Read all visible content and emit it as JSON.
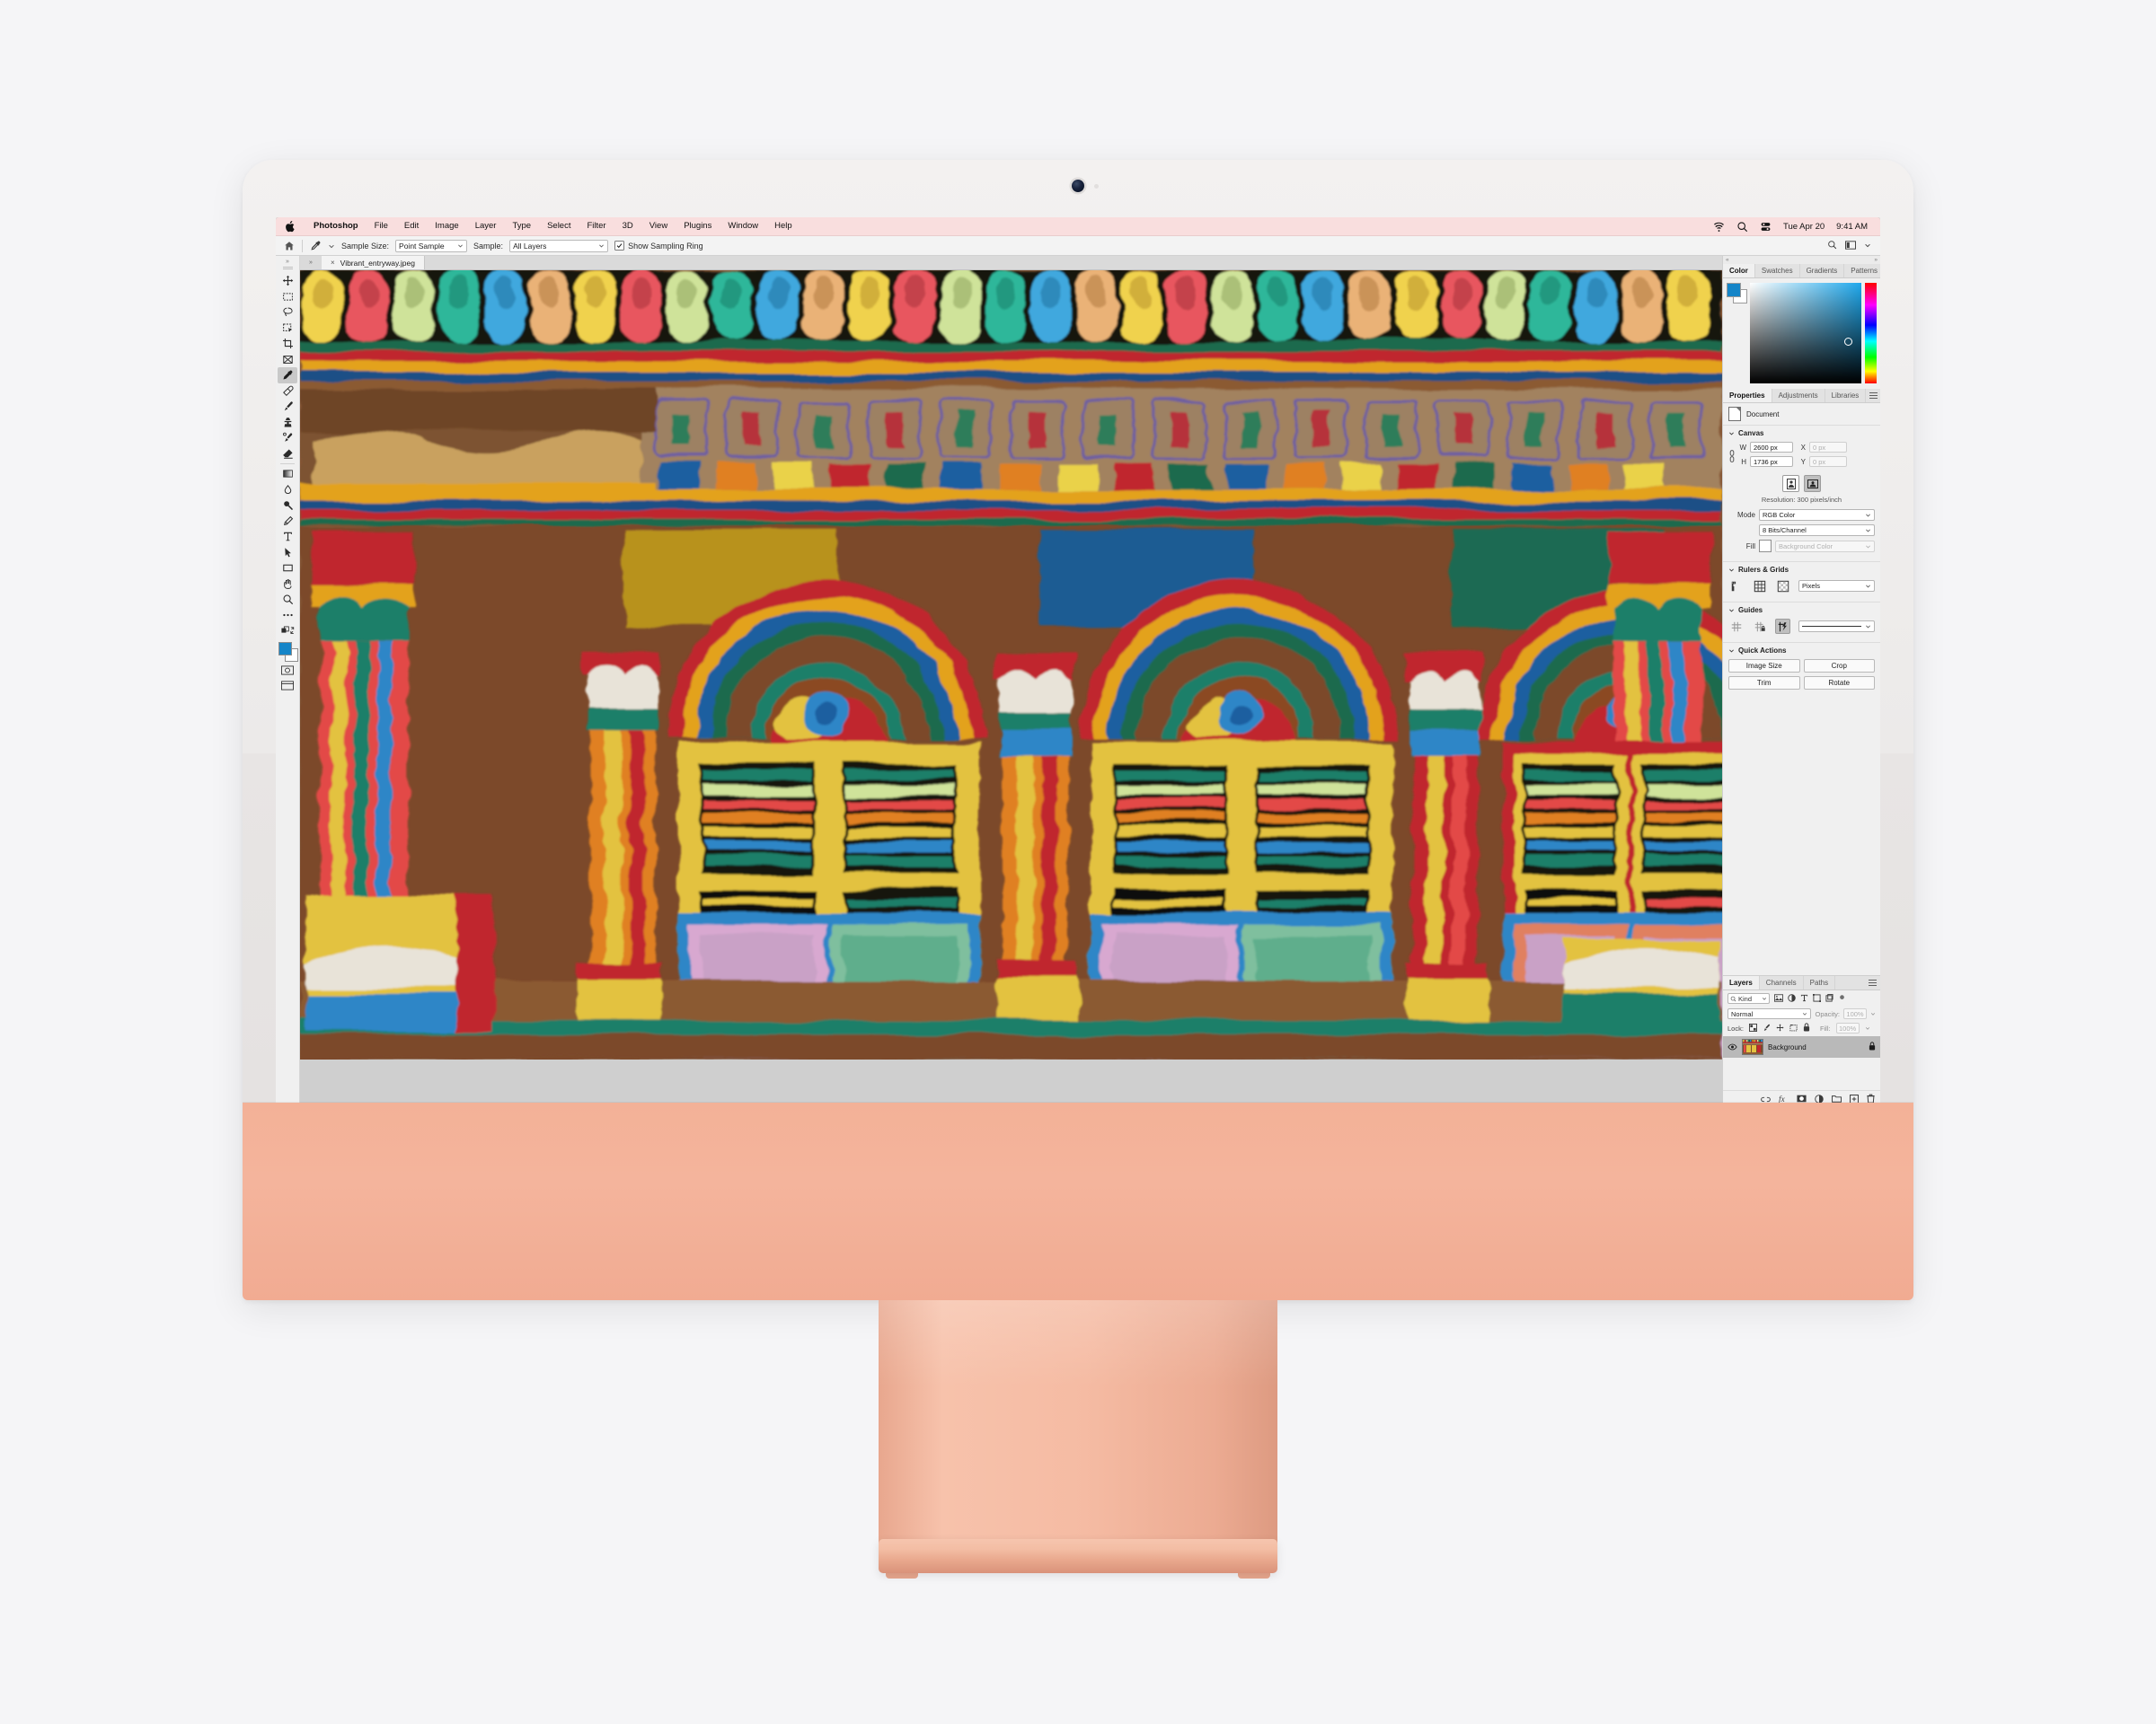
{
  "device": {
    "name": "iMac 24-inch",
    "color_name": "Orange",
    "chin_color": "#f4b49c",
    "bezel_color": "#eceae9"
  },
  "menubar": {
    "apple_icon": "apple-logo-icon",
    "items": [
      "Photoshop",
      "File",
      "Edit",
      "Image",
      "Layer",
      "Type",
      "Select",
      "Filter",
      "3D",
      "View",
      "Plugins",
      "Window",
      "Help"
    ],
    "status_icons": [
      "wifi-icon",
      "search-icon",
      "control-center-icon"
    ],
    "date": "Tue Apr 20",
    "time": "9:41 AM"
  },
  "optionsbar": {
    "home_icon": "home-icon",
    "tool_icon": "eyedropper-icon",
    "sample_size_label": "Sample Size:",
    "sample_size_value": "Point Sample",
    "sample_label": "Sample:",
    "sample_value": "All Layers",
    "show_sampling_ring_label": "Show Sampling Ring",
    "show_sampling_ring_checked": true,
    "right_icons": [
      "search-icon",
      "workspace-icon",
      "chevron-down-icon"
    ]
  },
  "toolbar": {
    "collapse_glyph": "»",
    "tools": [
      {
        "name": "move-tool",
        "icon": "move-icon",
        "active": false
      },
      {
        "name": "marquee-tool",
        "icon": "rectangular-marquee-icon",
        "active": false
      },
      {
        "name": "lasso-tool",
        "icon": "lasso-icon",
        "active": false
      },
      {
        "name": "object-selection-tool",
        "icon": "object-selection-icon",
        "active": false
      },
      {
        "name": "crop-tool",
        "icon": "crop-icon",
        "active": false
      },
      {
        "name": "frame-tool",
        "icon": "frame-icon",
        "active": false
      },
      {
        "name": "eyedropper-tool",
        "icon": "eyedropper-icon",
        "active": true
      },
      {
        "name": "healing-brush-tool",
        "icon": "healing-brush-icon",
        "active": false
      },
      {
        "name": "brush-tool",
        "icon": "brush-icon",
        "active": false
      },
      {
        "name": "clone-stamp-tool",
        "icon": "clone-stamp-icon",
        "active": false
      },
      {
        "name": "history-brush-tool",
        "icon": "history-brush-icon",
        "active": false
      },
      {
        "name": "eraser-tool",
        "icon": "eraser-icon",
        "active": false
      },
      {
        "name": "gradient-tool",
        "icon": "gradient-icon",
        "active": false
      },
      {
        "name": "blur-tool",
        "icon": "blur-drop-icon",
        "active": false
      },
      {
        "name": "dodge-tool",
        "icon": "dodge-icon",
        "active": false
      },
      {
        "name": "pen-tool",
        "icon": "pen-icon",
        "active": false
      },
      {
        "name": "type-tool",
        "icon": "type-t-icon",
        "active": false
      },
      {
        "name": "path-selection-tool",
        "icon": "path-arrow-icon",
        "active": false
      },
      {
        "name": "rectangle-tool",
        "icon": "rectangle-icon",
        "active": false
      },
      {
        "name": "hand-tool",
        "icon": "hand-icon",
        "active": false
      },
      {
        "name": "zoom-tool",
        "icon": "magnifier-icon",
        "active": false
      },
      {
        "name": "edit-toolbar",
        "icon": "ellipsis-icon",
        "active": false
      }
    ],
    "foreground_color": "#1585c8",
    "background_color": "#ffffff",
    "quickmask_icon": "quick-mask-icon",
    "screenmode_icon": "screen-mode-icon"
  },
  "document": {
    "tab_title": "Vibrant_entryway.jpeg",
    "close_glyph": "×",
    "collapse_glyph": "»"
  },
  "color_panel": {
    "tabs": [
      "Color",
      "Swatches",
      "Gradients",
      "Patterns"
    ],
    "active_tab": "Color",
    "foreground": "#1585c8",
    "background": "#ffffff",
    "menu_icon": "panel-menu-icon"
  },
  "properties_panel": {
    "tabs": [
      "Properties",
      "Adjustments",
      "Libraries"
    ],
    "active_tab": "Properties",
    "menu_icon": "panel-menu-icon",
    "header_label": "Document",
    "header_icon": "document-icon",
    "canvas": {
      "title": "Canvas",
      "w_label": "W",
      "w_value": "2600 px",
      "h_label": "H",
      "h_value": "1736 px",
      "x_label": "X",
      "x_value": "0 px",
      "y_label": "Y",
      "y_value": "0 px",
      "link_icon": "link-chain-icon",
      "orientation_portrait_icon": "portrait-orientation-icon",
      "orientation_landscape_icon": "landscape-orientation-icon",
      "orientation_selected": "landscape",
      "resolution_text": "Resolution: 300 pixels/inch",
      "mode_label": "Mode",
      "mode_value": "RGB Color",
      "depth_value": "8 Bits/Channel",
      "fill_label": "Fill",
      "fill_value": "Background Color",
      "fill_swatch": "#ffffff"
    },
    "rulers_grids": {
      "title": "Rulers & Grids",
      "icons": [
        "rulers-icon",
        "grid-icon",
        "transparency-grid-icon"
      ],
      "units_value": "Pixels"
    },
    "guides": {
      "title": "Guides",
      "icons": [
        "show-guides-icon",
        "lock-guides-icon",
        "smart-guides-icon"
      ],
      "selected_icon": "smart-guides-icon",
      "style_value": "——————"
    },
    "quick_actions": {
      "title": "Quick Actions",
      "buttons": [
        "Image Size",
        "Crop",
        "Trim",
        "Rotate"
      ]
    }
  },
  "layers_panel": {
    "tabs": [
      "Layers",
      "Channels",
      "Paths"
    ],
    "active_tab": "Layers",
    "menu_icon": "panel-menu-icon",
    "filter_kind_label": "Kind",
    "filter_icons": [
      "filter-image-icon",
      "filter-adjustment-icon",
      "filter-type-icon",
      "filter-shape-icon",
      "filter-smartobject-icon",
      "filter-toggle-icon"
    ],
    "blend_mode": "Normal",
    "opacity_label": "Opacity:",
    "opacity_value": "100%",
    "lock_label": "Lock:",
    "lock_icons": [
      "lock-transparent-pixels-icon",
      "lock-image-pixels-icon",
      "lock-position-icon",
      "lock-artboard-icon",
      "lock-all-icon"
    ],
    "fill_label": "Fill:",
    "fill_value": "100%",
    "layers": [
      {
        "name": "Background",
        "visible": true,
        "locked": true,
        "visibility_icon": "eye-icon",
        "lock_icon": "lock-icon",
        "thumbnail": "document-thumbnail"
      }
    ],
    "footer_icons": [
      "link-layers-icon",
      "layer-style-fx-icon",
      "layer-mask-icon",
      "adjustment-layer-icon",
      "new-group-icon",
      "new-layer-icon",
      "delete-layer-icon"
    ]
  },
  "canvas_image": {
    "description": "Oil-paint filtered photograph of a brightly painted heritage shophouse facade with three arched doorways, louvered shutters and decorative cornice"
  }
}
